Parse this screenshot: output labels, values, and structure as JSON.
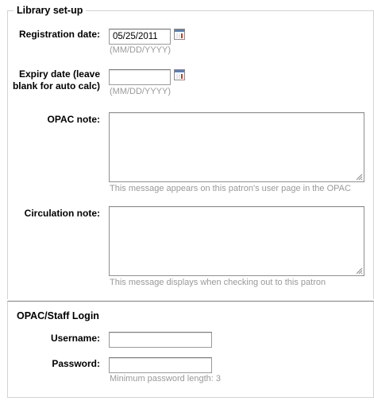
{
  "library_setup": {
    "legend": "Library set-up",
    "registration_date": {
      "label": "Registration date:",
      "value": "05/25/2011",
      "hint": "(MM/DD/YYYY)"
    },
    "expiry_date": {
      "label": "Expiry date (leave blank for auto calc)",
      "value": "",
      "hint": "(MM/DD/YYYY)"
    },
    "opac_note": {
      "label": "OPAC note:",
      "value": "",
      "hint": "This message appears on this patron's user page in the OPAC"
    },
    "circulation_note": {
      "label": "Circulation note:",
      "value": "",
      "hint": "This message displays when checking out to this patron"
    }
  },
  "login": {
    "legend": "OPAC/Staff Login",
    "username": {
      "label": "Username:",
      "value": ""
    },
    "password": {
      "label": "Password:",
      "value": "",
      "hint": "Minimum password length: 3"
    }
  },
  "icons": {
    "calendar": "calendar-icon",
    "resize": "resize-grip-icon"
  }
}
